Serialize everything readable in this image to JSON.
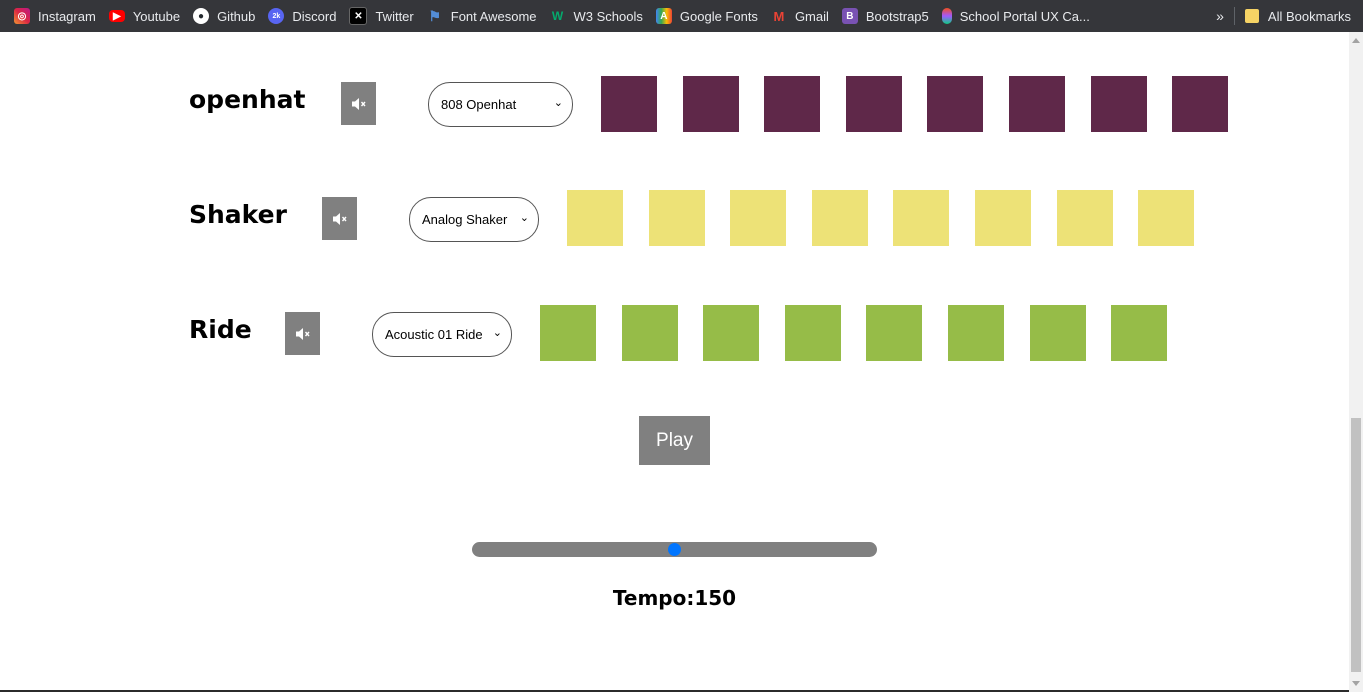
{
  "bookmarks_bar": {
    "items": [
      {
        "label": "Instagram",
        "icon": "instagram-icon",
        "color": "#e1306c"
      },
      {
        "label": "Youtube",
        "icon": "youtube-icon",
        "color": "#ff0000"
      },
      {
        "label": "Github",
        "icon": "github-icon",
        "color": "#ffffff"
      },
      {
        "label": "Discord",
        "icon": "discord-icon",
        "color": "#5865f2"
      },
      {
        "label": "Twitter",
        "icon": "x-icon",
        "color": "#000000"
      },
      {
        "label": "Font Awesome",
        "icon": "flag-icon",
        "color": "#538dd7"
      },
      {
        "label": "W3 Schools",
        "icon": "w3schools-icon",
        "color": "#04aa6d"
      },
      {
        "label": "Google Fonts",
        "icon": "google-fonts-icon",
        "color": "#fbbc04"
      },
      {
        "label": "Gmail",
        "icon": "gmail-icon",
        "color": "#ea4335"
      },
      {
        "label": "Bootstrap5",
        "icon": "bootstrap-icon",
        "color": "#7952b3"
      },
      {
        "label": "School Portal UX Ca...",
        "icon": "figma-icon",
        "color": "#f24e1e"
      }
    ],
    "overflow": "»",
    "all_bookmarks": "All Bookmarks"
  },
  "tracks": [
    {
      "name": "openhat",
      "sound": "808 Openhat",
      "pad_color": "#5f2849",
      "pads": 8
    },
    {
      "name": "Shaker",
      "sound": "Analog Shaker",
      "pad_color": "#ede277",
      "pads": 8
    },
    {
      "name": "Ride",
      "sound": "Acoustic 01 Ride",
      "pad_color": "#96bc48",
      "pads": 8
    }
  ],
  "mute_icon": "volume-mute-icon",
  "controls": {
    "play_label": "Play",
    "tempo_label": "Tempo:150",
    "tempo_value": 150,
    "slider_fraction": 0.5
  }
}
